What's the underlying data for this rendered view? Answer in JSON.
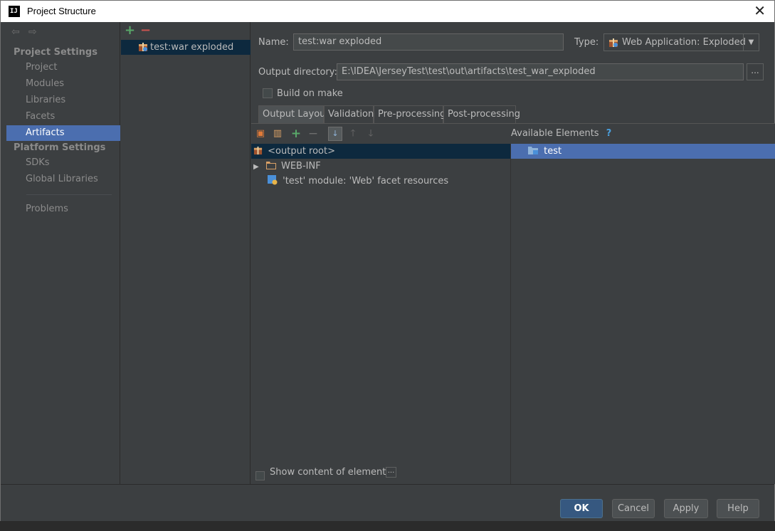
{
  "window": {
    "title": "Project Structure",
    "close_glyph": "✕",
    "app_icon_text": "IJ"
  },
  "nav": {
    "back_icon": "back-arrow-icon",
    "forward_icon": "forward-arrow-icon",
    "project_settings_label": "Project Settings",
    "project_items": [
      "Project",
      "Modules",
      "Libraries",
      "Facets",
      "Artifacts"
    ],
    "selected_item": "Artifacts",
    "platform_settings_label": "Platform Settings",
    "platform_items": [
      "SDKs",
      "Global Libraries"
    ],
    "problems_label": "Problems"
  },
  "artifacts_list": {
    "add_glyph": "+",
    "remove_glyph": "−",
    "items": [
      "test:war exploded"
    ]
  },
  "form": {
    "name_label": "Name:",
    "name_value": "test:war exploded",
    "type_label": "Type:",
    "type_value": "Web Application: Exploded",
    "output_dir_label": "Output directory:",
    "output_dir_value": "E:\\IDEA\\JerseyTest\\test\\out\\artifacts\\test_war_exploded",
    "browse_glyph": "...",
    "build_on_make_label": "Build on make"
  },
  "tabs": [
    "Output Layout",
    "Validation",
    "Pre-processing",
    "Post-processing"
  ],
  "active_tab": "Output Layout",
  "layout": {
    "available_elements_label": "Available Elements",
    "help_glyph": "?",
    "tree": [
      {
        "label": "<output root>",
        "icon": "war-archive-icon"
      },
      {
        "label": "WEB-INF",
        "icon": "folder-icon",
        "expander": "▶"
      },
      {
        "label": "'test' module: 'Web' facet resources",
        "icon": "web-facet-icon"
      }
    ],
    "available": [
      {
        "label": "test",
        "icon": "module-folder-icon"
      }
    ],
    "show_content_label": "Show content of elements",
    "show_content_more_glyph": "..."
  },
  "buttons": {
    "ok": "OK",
    "cancel": "Cancel",
    "apply": "Apply",
    "help": "Help"
  },
  "colors": {
    "selection_blue": "#4b6eaf",
    "selection_dark": "#0d293e",
    "add_green": "#59a869",
    "remove_red": "#c75450"
  }
}
